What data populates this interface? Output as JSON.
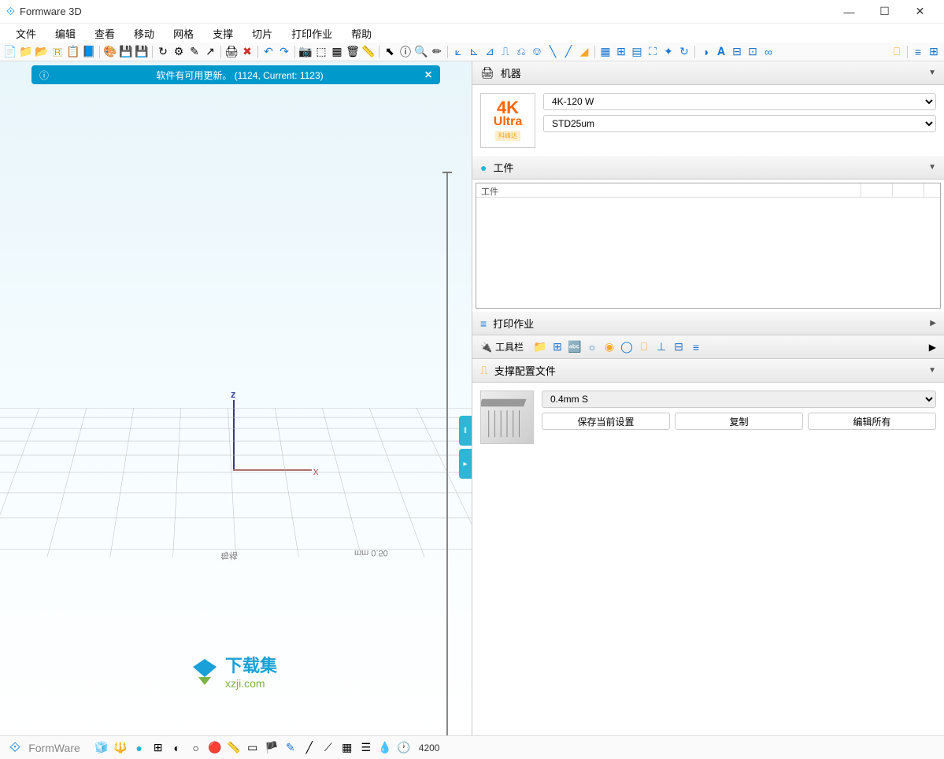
{
  "app": {
    "title": "Formware 3D"
  },
  "menu": [
    "文件",
    "编辑",
    "查看",
    "移动",
    "网格",
    "支撑",
    "切片",
    "打印作业",
    "帮助"
  ],
  "notification": {
    "text": "软件有可用更新。  (1124, Current: 1123)"
  },
  "axis": {
    "z": "z",
    "x": "x"
  },
  "ruler": {
    "scale": "0.50",
    "unit": "mm",
    "label": "每格"
  },
  "watermark": {
    "line1": "下载集",
    "line2": "xzji.com"
  },
  "panels": {
    "machine": {
      "title": "机器",
      "thumb": {
        "top": "4K",
        "mid": "Ultra",
        "brand": "科峰达"
      },
      "select1": "4K-120 W",
      "select2": "STD25um"
    },
    "parts": {
      "title": "工件",
      "header": "工件"
    },
    "printjob": {
      "title": "打印作业"
    },
    "toolbar": {
      "title": "工具栏"
    },
    "support": {
      "title": "支撑配置文件",
      "select": "0.4mm S",
      "btn_save": "保存当前设置",
      "btn_copy": "复制",
      "btn_edit": "编辑所有"
    }
  },
  "status": {
    "brand": "FormWare",
    "value": "4200"
  }
}
